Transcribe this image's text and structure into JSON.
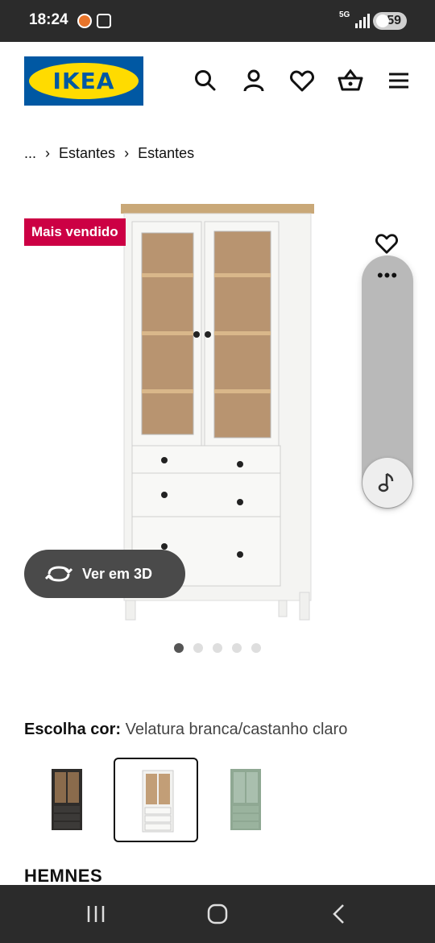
{
  "status_bar": {
    "time": "18:24",
    "network": "5G",
    "battery": "59"
  },
  "header": {
    "logo_text": "IKEA"
  },
  "breadcrumb": {
    "ellipsis": "...",
    "items": [
      "Estantes",
      "Estantes"
    ]
  },
  "product": {
    "badge": "Mais vendido",
    "view_3d_label": "Ver em 3D",
    "gallery": {
      "count": 5,
      "active_index": 0
    },
    "color_label": "Escolha cor:",
    "color_value": "Velatura branca/castanho claro",
    "swatches": [
      "dark",
      "white",
      "green"
    ],
    "selected_swatch": 1,
    "name": "HEMNES"
  },
  "side_panel": {
    "dots": "•••"
  },
  "colors": {
    "ikea_blue": "#0058a3",
    "ikea_yellow": "#ffdb00",
    "badge_red": "#cc0044"
  }
}
